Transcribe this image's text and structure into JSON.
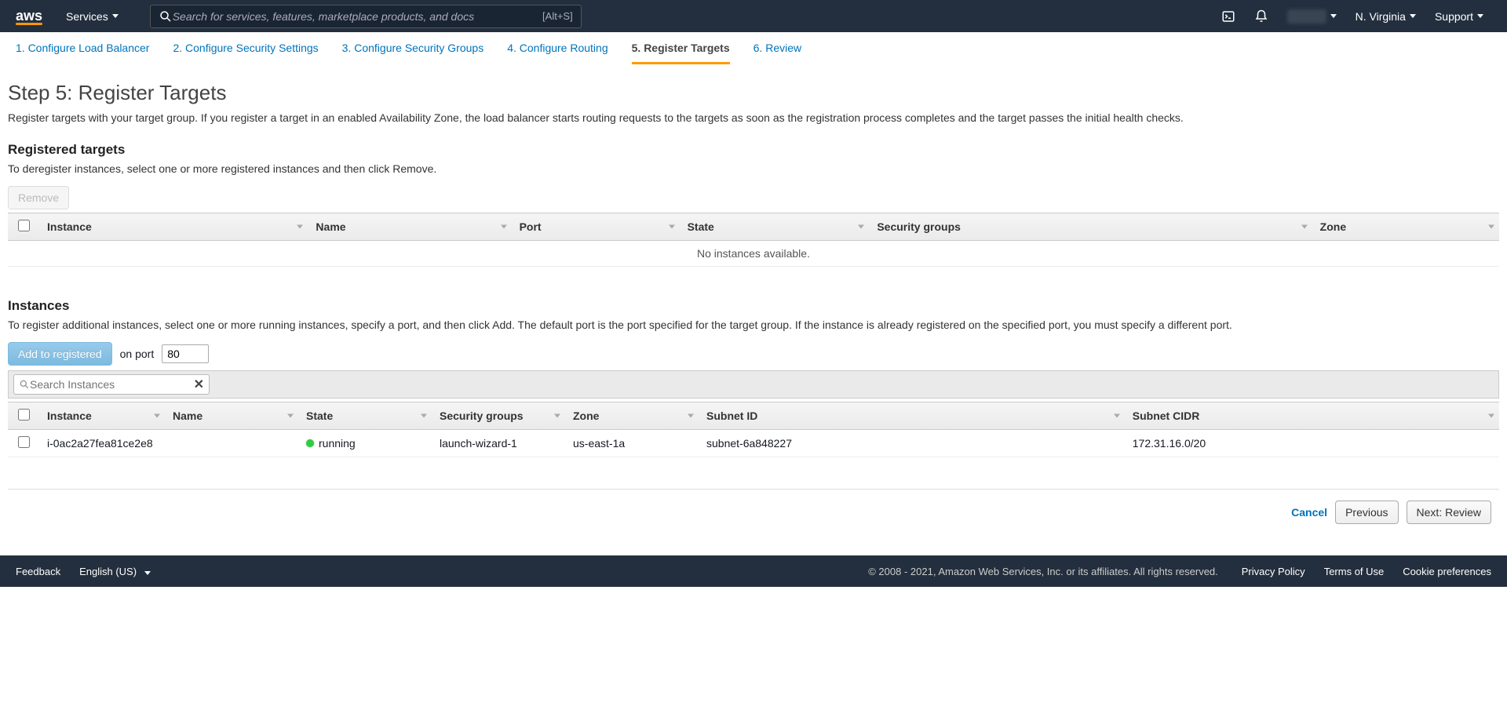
{
  "nav": {
    "services": "Services",
    "search_placeholder": "Search for services, features, marketplace products, and docs",
    "search_shortcut": "[Alt+S]",
    "region": "N. Virginia",
    "support": "Support"
  },
  "wizard_steps": [
    {
      "label": "1. Configure Load Balancer",
      "active": false
    },
    {
      "label": "2. Configure Security Settings",
      "active": false
    },
    {
      "label": "3. Configure Security Groups",
      "active": false
    },
    {
      "label": "4. Configure Routing",
      "active": false
    },
    {
      "label": "5. Register Targets",
      "active": true
    },
    {
      "label": "6. Review",
      "active": false
    }
  ],
  "page": {
    "title": "Step 5: Register Targets",
    "description": "Register targets with your target group. If you register a target in an enabled Availability Zone, the load balancer starts routing requests to the targets as soon as the registration process completes and the target passes the initial health checks."
  },
  "registered": {
    "title": "Registered targets",
    "description": "To deregister instances, select one or more registered instances and then click Remove.",
    "remove_label": "Remove",
    "columns": [
      "Instance",
      "Name",
      "Port",
      "State",
      "Security groups",
      "Zone"
    ],
    "empty": "No instances available."
  },
  "instances": {
    "title": "Instances",
    "description": "To register additional instances, select one or more running instances, specify a port, and then click Add. The default port is the port specified for the target group. If the instance is already registered on the specified port, you must specify a different port.",
    "add_label": "Add to registered",
    "on_port_label": "on port",
    "port_value": "80",
    "search_placeholder": "Search Instances",
    "columns": [
      "Instance",
      "Name",
      "State",
      "Security groups",
      "Zone",
      "Subnet ID",
      "Subnet CIDR"
    ],
    "rows": [
      {
        "instance": "i-0ac2a27fea81ce2e8",
        "name": "",
        "state": "running",
        "security_groups": "launch-wizard-1",
        "zone": "us-east-1a",
        "subnet_id": "subnet-6a848227",
        "subnet_cidr": "172.31.16.0/20"
      }
    ]
  },
  "actions": {
    "cancel": "Cancel",
    "previous": "Previous",
    "next": "Next: Review"
  },
  "footer": {
    "feedback": "Feedback",
    "language": "English (US)",
    "copyright": "© 2008 - 2021, Amazon Web Services, Inc. or its affiliates. All rights reserved.",
    "privacy": "Privacy Policy",
    "terms": "Terms of Use",
    "cookies": "Cookie preferences"
  }
}
